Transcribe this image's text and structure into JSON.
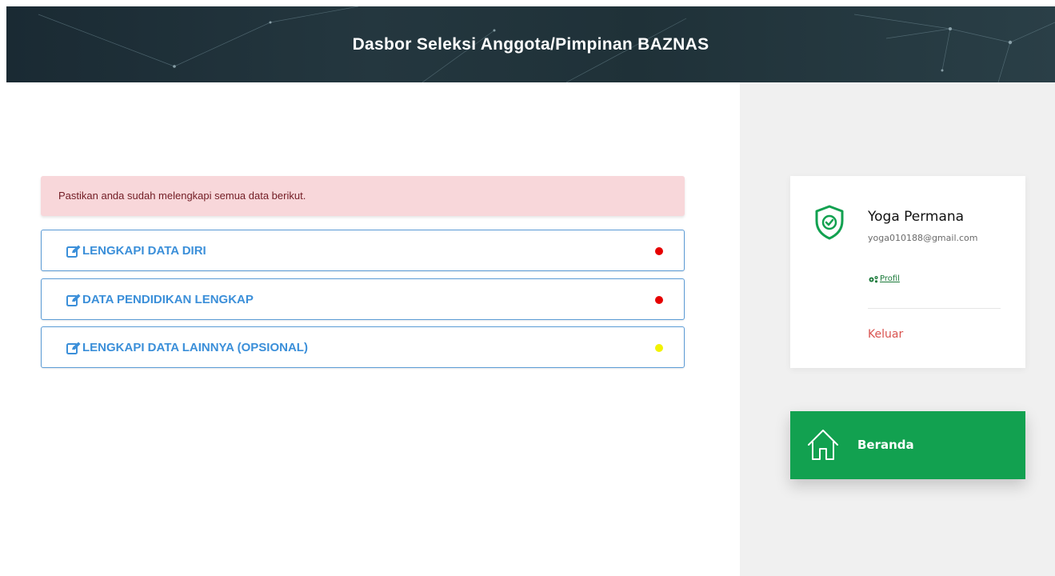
{
  "header": {
    "title": "Dasbor Seleksi Anggota/Pimpinan BAZNAS"
  },
  "alert": {
    "text": "Pastikan anda sudah melengkapi semua data berikut."
  },
  "checklist": [
    {
      "label": "LENGKAPI DATA DIRI",
      "status_color": "#e60000",
      "icon": "edit-icon"
    },
    {
      "label": "DATA PENDIDIKAN LENGKAP",
      "status_color": "#e60000",
      "icon": "edit-icon"
    },
    {
      "label": "LENGKAPI DATA LAINNYA (OPSIONAL)",
      "status_color": "#f2f200",
      "icon": "edit-icon"
    }
  ],
  "profile": {
    "name": "Yoga Permana",
    "email": "yoga010188@gmail.com",
    "profile_link": "Profil",
    "logout": "Keluar",
    "icon": "shield-check-icon"
  },
  "home": {
    "label": "Beranda",
    "icon": "home-icon"
  },
  "colors": {
    "accent_blue": "#3b8fd9",
    "brand_green": "#12a150",
    "alert_bg": "#f8d7da",
    "alert_text": "#721c24",
    "logout_red": "#d9534f"
  }
}
